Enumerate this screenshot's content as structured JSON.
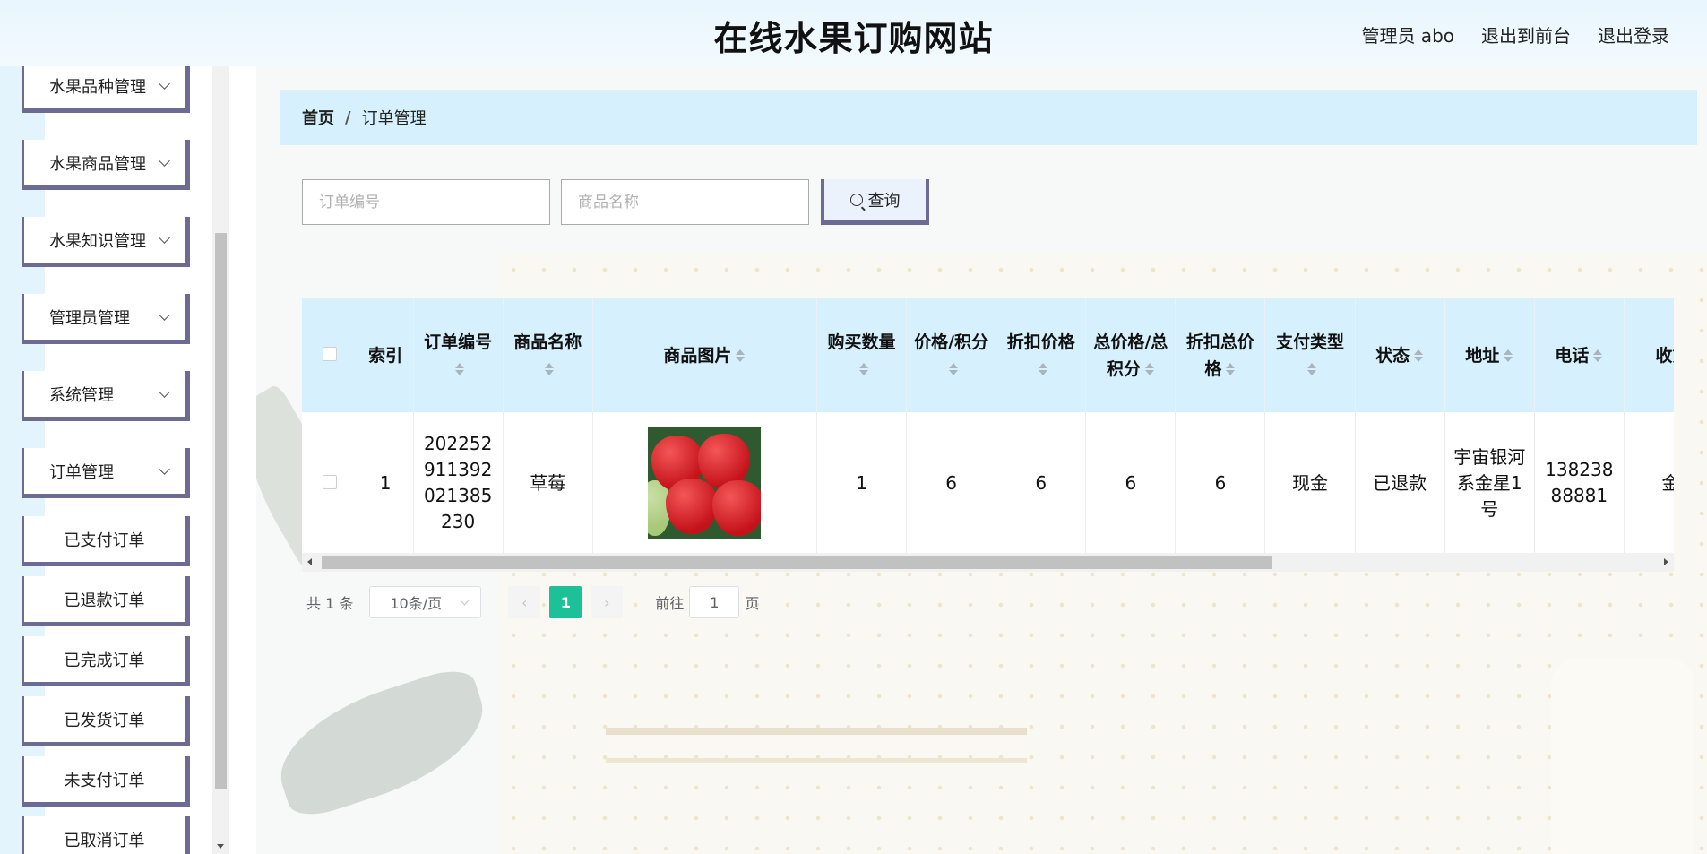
{
  "header": {
    "title": "在线水果订购网站",
    "admin_label": "管理员 abo",
    "to_frontend": "退出到前台",
    "logout": "退出登录"
  },
  "sidebar": {
    "menus": [
      {
        "label": "水果品种管理"
      },
      {
        "label": "水果商品管理"
      },
      {
        "label": "水果知识管理"
      },
      {
        "label": "管理员管理"
      },
      {
        "label": "系统管理"
      },
      {
        "label": "订单管理"
      }
    ],
    "order_submenu": [
      {
        "label": "已支付订单"
      },
      {
        "label": "已退款订单"
      },
      {
        "label": "已完成订单"
      },
      {
        "label": "已发货订单"
      },
      {
        "label": "未支付订单"
      },
      {
        "label": "已取消订单"
      }
    ]
  },
  "breadcrumb": {
    "home": "首页",
    "separator": "/",
    "current": "订单管理"
  },
  "search": {
    "order_no_placeholder": "订单编号",
    "product_name_placeholder": "商品名称",
    "button_label": "查询"
  },
  "table": {
    "columns": [
      "索引",
      "订单编号",
      "商品名称",
      "商品图片",
      "购买数量",
      "价格/积分",
      "折扣价格",
      "总价格/总积分",
      "折扣总价格",
      "支付类型",
      "状态",
      "地址",
      "电话",
      "收货"
    ],
    "rows": [
      {
        "index": "1",
        "order_no": "202252911392021385230",
        "product_name": "草莓",
        "image_alt": "草莓",
        "quantity": "1",
        "price": "6",
        "discount_price": "6",
        "total_price": "6",
        "discount_total": "6",
        "pay_type": "现金",
        "status": "已退款",
        "address": "宇宙银河系金星1号",
        "phone": "13823888881",
        "receiver": "金星"
      }
    ]
  },
  "pagination": {
    "total": "共 1 条",
    "page_size": "10条/页",
    "prev": "‹",
    "current_page": "1",
    "next": "›",
    "goto_prefix": "前往",
    "goto_value": "1",
    "goto_suffix": "页"
  },
  "colors": {
    "accent": "#1cc198",
    "header_bg": "#e8f6fd",
    "table_header_bg": "#d6f1fd",
    "menu_border": "#6d6a93"
  }
}
